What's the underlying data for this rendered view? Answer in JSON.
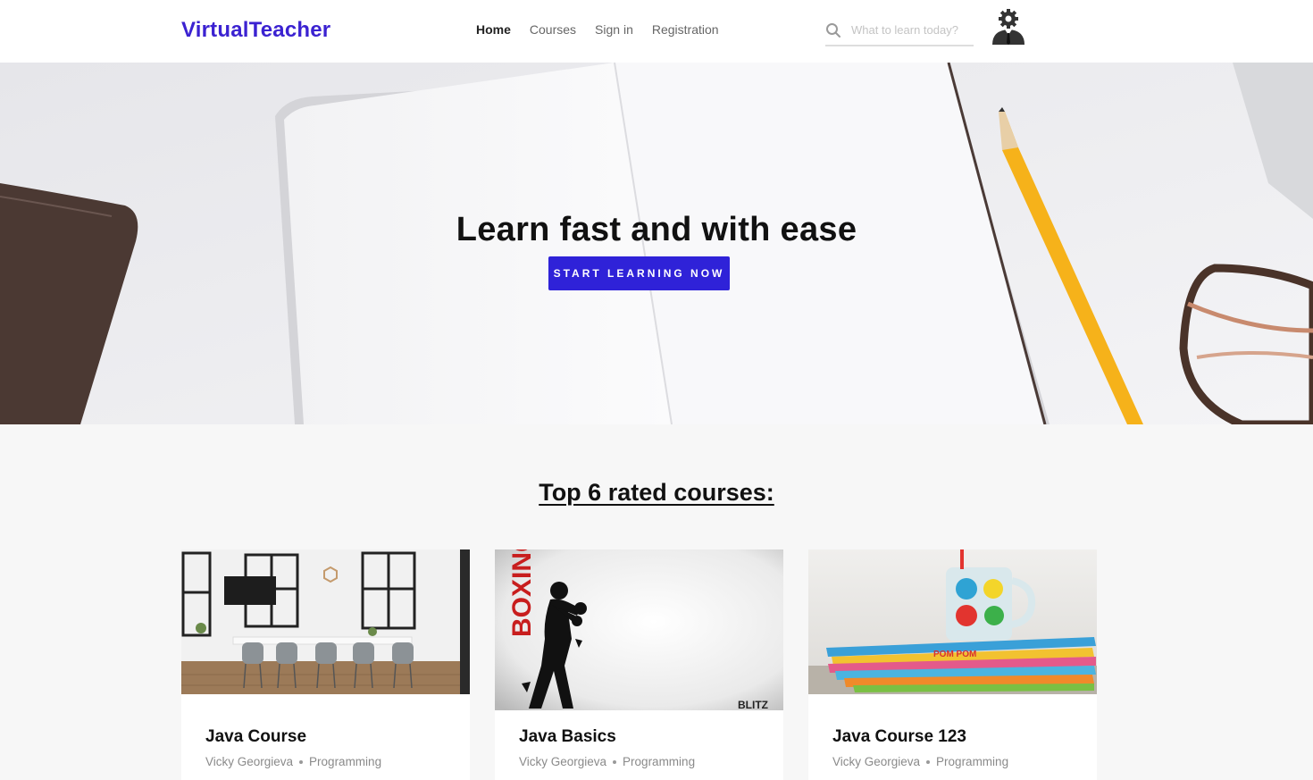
{
  "header": {
    "logo": "VirtualTeacher",
    "nav": [
      {
        "label": "Home",
        "active": true
      },
      {
        "label": "Courses",
        "active": false
      },
      {
        "label": "Sign in",
        "active": false
      },
      {
        "label": "Registration",
        "active": false
      }
    ],
    "search_placeholder": "What to learn today?",
    "search_icon": "search-icon",
    "avatar_icon": "user-settings-icon"
  },
  "hero": {
    "title": "Learn fast and with ease",
    "button": "START LEARNING NOW"
  },
  "section": {
    "title": "Top 6 rated courses:"
  },
  "courses": [
    {
      "title": "Java Course",
      "teacher": "Vicky Georgieva",
      "topic": "Programming"
    },
    {
      "title": "Java Basics",
      "teacher": "Vicky Georgieva",
      "topic": "Programming",
      "image_text": [
        "BOXING",
        "BLITZ"
      ]
    },
    {
      "title": "Java Course 123",
      "teacher": "Vicky Georgieva",
      "topic": "Programming",
      "image_text": [
        "POM POM"
      ]
    }
  ],
  "colors": {
    "brand": "#3b22d1",
    "button": "#2f22d8",
    "page_bg": "#f7f7f7"
  }
}
